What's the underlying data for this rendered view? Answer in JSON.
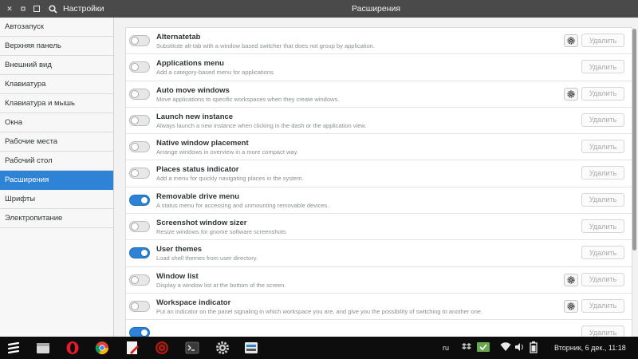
{
  "app": {
    "name": "Настройки",
    "page_title": "Расширения"
  },
  "sidebar": {
    "items": [
      {
        "label": "Автозапуск"
      },
      {
        "label": "Верхняя панель"
      },
      {
        "label": "Внешний вид"
      },
      {
        "label": "Клавиатура"
      },
      {
        "label": "Клавиатура и мышь"
      },
      {
        "label": "Окна"
      },
      {
        "label": "Рабочие места"
      },
      {
        "label": "Рабочий стол"
      },
      {
        "label": "Расширения",
        "active": true
      },
      {
        "label": "Шрифты"
      },
      {
        "label": "Электропитание"
      }
    ]
  },
  "extensions": [
    {
      "name": "Alternatetab",
      "description": "Substitute alt-tab with a window based switcher that does not group by application.",
      "enabled": false,
      "has_settings": true,
      "remove_label": "Удалить"
    },
    {
      "name": "Applications menu",
      "description": "Add a category-based menu for applications.",
      "enabled": false,
      "has_settings": false,
      "remove_label": "Удалить"
    },
    {
      "name": "Auto move windows",
      "description": "Move applications to specific workspaces when they create windows.",
      "enabled": false,
      "has_settings": true,
      "remove_label": "Удалить"
    },
    {
      "name": "Launch new instance",
      "description": "Always launch a new instance when clicking in the dash or the application view.",
      "enabled": false,
      "has_settings": false,
      "remove_label": "Удалить"
    },
    {
      "name": "Native window placement",
      "description": "Arrange windows in overview in a more compact way.",
      "enabled": false,
      "has_settings": false,
      "remove_label": "Удалить"
    },
    {
      "name": "Places status indicator",
      "description": "Add a menu for quickly navigating places in the system.",
      "enabled": false,
      "has_settings": false,
      "remove_label": "Удалить"
    },
    {
      "name": "Removable drive menu",
      "description": "A status menu for accessing and unmounting removable devices.",
      "enabled": true,
      "has_settings": false,
      "remove_label": "Удалить"
    },
    {
      "name": "Screenshot window sizer",
      "description": "Resize windows for gnome software screenshots",
      "enabled": false,
      "has_settings": false,
      "remove_label": "Удалить"
    },
    {
      "name": "User themes",
      "description": "Load shell themes from user directory.",
      "enabled": true,
      "has_settings": false,
      "remove_label": "Удалить"
    },
    {
      "name": "Window list",
      "description": "Display a window list at the bottom of the screen.",
      "enabled": false,
      "has_settings": true,
      "remove_label": "Удалить"
    },
    {
      "name": "Workspace indicator",
      "description": "Put an indicator on the panel signaling in which workspace you are, and give you the possibility of switching to another one.",
      "enabled": false,
      "has_settings": true,
      "remove_label": "Удалить"
    },
    {
      "name": "",
      "description": "",
      "enabled": true,
      "has_settings": false,
      "remove_label": "Удалить"
    }
  ],
  "taskbar": {
    "apps": [
      "menu-icon",
      "files-icon",
      "opera-icon",
      "chrome-icon",
      "text-editor-icon",
      "media-player-icon",
      "terminal-icon",
      "settings-icon",
      "software-manager-icon"
    ],
    "keyboard_layout": "ru",
    "clock": "Вторник,  6 дек., 11:18"
  },
  "colors": {
    "accent": "#2f83d6",
    "titlebar": "#4a4a4a",
    "taskbar": "#0d0d0d"
  }
}
